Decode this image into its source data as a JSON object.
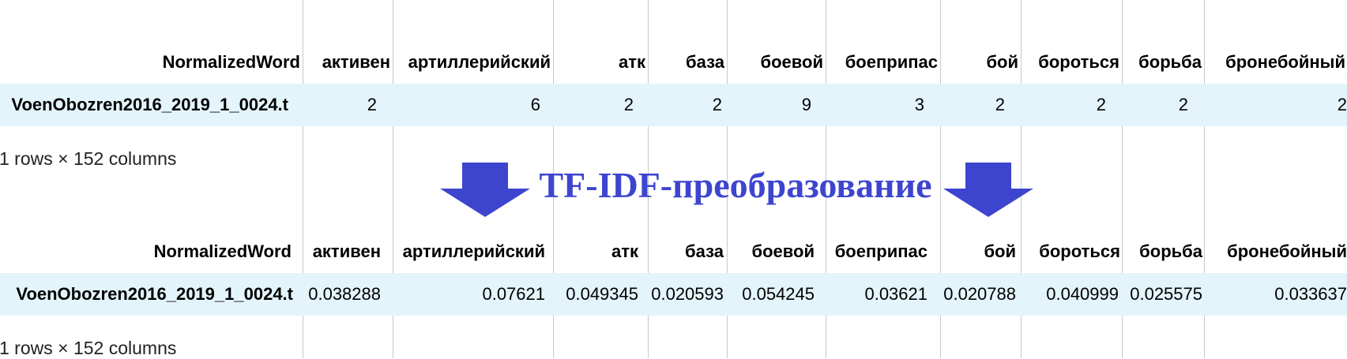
{
  "table1": {
    "index_header": "NormalizedWord",
    "columns": [
      "активен",
      "артиллерийский",
      "атк",
      "база",
      "боевой",
      "боеприпас",
      "бой",
      "бороться",
      "борьба",
      "бронебойный"
    ],
    "row_label": "VoenObozren2016_2019_1_0024.t",
    "values": [
      "2",
      "6",
      "2",
      "2",
      "9",
      "3",
      "2",
      "2",
      "2",
      "2"
    ],
    "caption": "1 rows × 152 columns"
  },
  "transform_label": "TF-IDF-преобразование",
  "table2": {
    "index_header": "NormalizedWord",
    "columns": [
      "активен",
      "артиллерийский",
      "атк",
      "база",
      "боевой",
      "боеприпас",
      "бой",
      "бороться",
      "борьба",
      "бронебойный"
    ],
    "row_label": "VoenObozren2016_2019_1_0024.t",
    "values": [
      "0.038288",
      "0.07621",
      "0.049345",
      "0.020593",
      "0.054245",
      "0.03621",
      "0.020788",
      "0.040999",
      "0.025575",
      "0.033637"
    ],
    "caption": "1 rows × 152 columns"
  },
  "colors": {
    "accent": "#3d45cf",
    "row_highlight": "#e3f4fb",
    "gridline": "#c8c8c8"
  },
  "icons": {
    "transform_arrows": "down-arrow-icon"
  }
}
